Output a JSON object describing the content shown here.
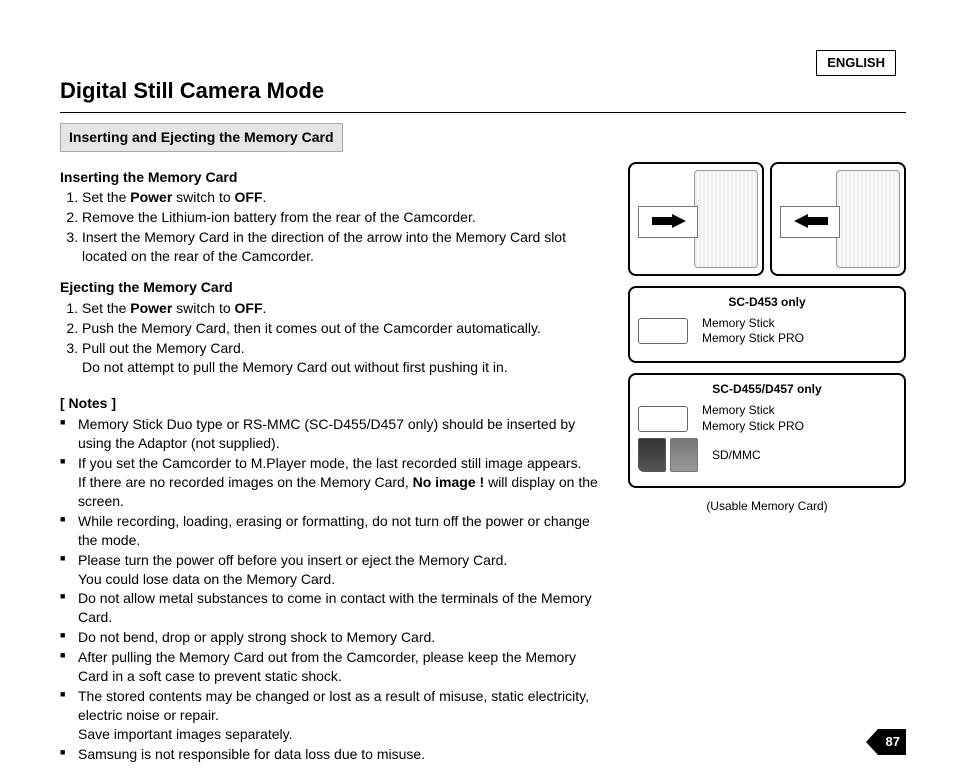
{
  "language": "ENGLISH",
  "title": "Digital Still Camera Mode",
  "subtitle": "Inserting and Ejecting the Memory Card",
  "inserting": {
    "head": "Inserting the Memory Card",
    "s1a": "Set the ",
    "s1b": "Power",
    "s1c": " switch to ",
    "s1d": "OFF",
    "s1e": ".",
    "s2": "Remove the Lithium-ion battery from the rear of the Camcorder.",
    "s3": "Insert the Memory Card in the direction of the arrow into the Memory Card slot located on the rear of the Camcorder."
  },
  "ejecting": {
    "head": "Ejecting the Memory Card",
    "s1a": "Set the ",
    "s1b": "Power",
    "s1c": " switch to ",
    "s1d": "OFF",
    "s1e": ".",
    "s2": "Push the Memory Card, then it comes out of the Camcorder automatically.",
    "s3a": "Pull out the Memory Card.",
    "s3b": "Do not attempt to pull the Memory Card out without first pushing it in."
  },
  "notes_head": "[ Notes ]",
  "notes": {
    "n1": "Memory Stick Duo type or RS-MMC (SC-D455/D457 only) should be inserted by using the Adaptor (not supplied).",
    "n2a": "If you set the Camcorder to M.Player mode, the last recorded still image appears.",
    "n2b_a": "If there are no recorded images on the Memory Card, ",
    "n2b_b": "No image !",
    "n2b_c": " will display on the screen.",
    "n3": "While recording, loading, erasing or formatting, do not turn off the power or change the mode.",
    "n4a": "Please turn the power off before you insert or eject the Memory Card.",
    "n4b": "You could lose data on the Memory Card.",
    "n5": "Do not allow metal substances to come in contact with the terminals of the Memory Card.",
    "n6": "Do not bend, drop or apply strong shock to Memory Card.",
    "n7": "After pulling the Memory Card out from the Camcorder, please keep the Memory Card in a soft case to prevent static shock.",
    "n8a": "The stored contents may be changed or lost as a result of misuse, static electricity, electric noise or repair.",
    "n8b": "Save important images separately.",
    "n9": "Samsung is not responsible for data loss due to misuse."
  },
  "right": {
    "model1": "SC-D453 only",
    "ms_line1": "Memory Stick",
    "ms_line2": "Memory Stick PRO",
    "model2": "SC-D455/D457 only",
    "sdmmc": "SD/MMC",
    "usable": "(Usable Memory Card)"
  },
  "page_number": "87"
}
